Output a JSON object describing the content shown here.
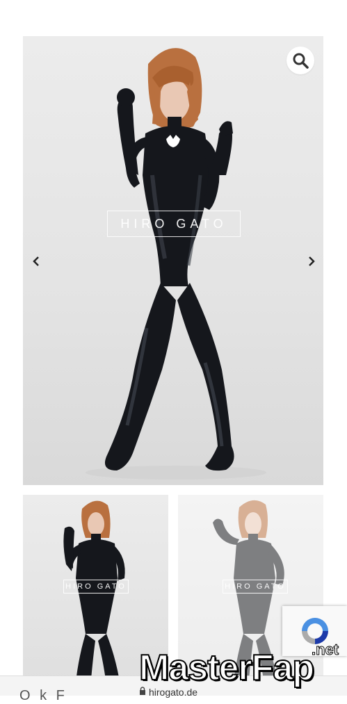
{
  "gallery": {
    "watermark": "HIRO GATO",
    "thumb_watermark": "HIRO GATO",
    "zoom_icon": "search-icon",
    "prev_icon": "chevron-left-icon",
    "next_icon": "chevron-right-icon"
  },
  "overlay": {
    "brand_master": "Master",
    "brand_fap": "Fap",
    "brand_net": ".net"
  },
  "browser": {
    "url": "hirogato.de",
    "partial_text": "O k F"
  },
  "colors": {
    "suit": "#15171c",
    "skin": "#e9c8b4",
    "hair": "#b9703f",
    "background": "#e6e6e6"
  }
}
